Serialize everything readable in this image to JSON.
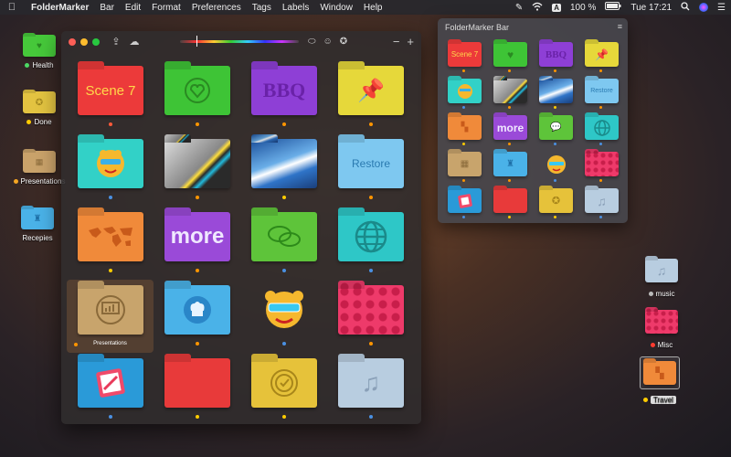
{
  "menubar": {
    "app": "FolderMarker",
    "items": [
      "Bar",
      "Edit",
      "Format",
      "Preferences",
      "Tags",
      "Labels",
      "Window",
      "Help"
    ],
    "battery": "100 %",
    "input_source": "A",
    "clock": "Tue 17:21"
  },
  "desktop_left": [
    {
      "label": "Health",
      "color": "#46c83a",
      "dot": "#4cd964",
      "icon": "heart-icon"
    },
    {
      "label": "Done",
      "color": "#e3c341",
      "dot": "#ffcc00",
      "icon": "badge-icon"
    },
    {
      "label": "Presentations",
      "color": "#c9a26a",
      "dot": "#f5a623",
      "icon": "presentation-icon"
    },
    {
      "label": "Recepies",
      "color": "#4ab2e8",
      "dot": "",
      "icon": "chef-hat-icon"
    }
  ],
  "main_window": {
    "folders": [
      {
        "name": "Scene 7",
        "text": "Scene 7",
        "color": "#ec3a3a",
        "dot": "#ff5a3a",
        "icon": ""
      },
      {
        "name": "Health",
        "text": "",
        "color": "#3ec436",
        "dot": "#ff9500",
        "icon": "heart-icon"
      },
      {
        "name": "BBQ",
        "text": "BBQ",
        "color": "#8e3fd6",
        "dot": "#ff9500",
        "icon": ""
      },
      {
        "name": "Pin",
        "text": "",
        "color": "#e6d83a",
        "dot": "#ff9500",
        "icon": "pin-icon"
      },
      {
        "name": "Tiger",
        "text": "",
        "color": "#32d1c7",
        "dot": "#4a90e2",
        "icon": "tiger-icon"
      },
      {
        "name": "Statue",
        "text": "",
        "color": "#555",
        "dot": "#ff9500",
        "icon": "statue-image"
      },
      {
        "name": "Sky",
        "text": "",
        "color": "#2f74c8",
        "dot": "#ffcc00",
        "icon": "photo-image"
      },
      {
        "name": "Restore",
        "text": "Restore",
        "color": "#7ec8f0",
        "dot": "#ff9500",
        "icon": ""
      },
      {
        "name": "Travel",
        "text": "",
        "color": "#f08a3a",
        "dot": "#ffcc00",
        "icon": "world-map-icon"
      },
      {
        "name": "more",
        "text": "more",
        "color": "#9a4ad8",
        "dot": "#ff9500",
        "icon": ""
      },
      {
        "name": "Chat",
        "text": "",
        "color": "#5ec43a",
        "dot": "#4a90e2",
        "icon": "chat-icon"
      },
      {
        "name": "Globe",
        "text": "",
        "color": "#2ec7c7",
        "dot": "#4a90e2",
        "icon": "globe-icon"
      },
      {
        "name": "Presentations",
        "text": "",
        "color": "#c8a46c",
        "dot": "#ff9500",
        "icon": "presentation-icon",
        "label": "Presentations",
        "selected": true
      },
      {
        "name": "Recepies",
        "text": "",
        "color": "#4ab2e8",
        "dot": "#ff9500",
        "icon": "chef-hat-icon"
      },
      {
        "name": "Tiger glasses",
        "text": "",
        "color": "transparent",
        "dot": "#4a90e2",
        "icon": "tiger-icon"
      },
      {
        "name": "Dots",
        "text": "",
        "color": "#ee3a6a",
        "dot": "#ff9500",
        "icon": "dots-pattern"
      },
      {
        "name": "Edit",
        "text": "",
        "color": "#2a9ad8",
        "dot": "#4a90e2",
        "icon": "pencil-icon"
      },
      {
        "name": "Red",
        "text": "",
        "color": "#e83a3a",
        "dot": "#ffcc00",
        "icon": ""
      },
      {
        "name": "Done",
        "text": "",
        "color": "#e6c23a",
        "dot": "#ffcc00",
        "icon": "badge-icon"
      },
      {
        "name": "Music",
        "text": "",
        "color": "#b8cde0",
        "dot": "#4a90e2",
        "icon": "music-note-icon"
      }
    ]
  },
  "bar_panel": {
    "title": "FolderMarker Bar",
    "menu_icon": "list-icon",
    "folders": [
      {
        "text": "Scene 7",
        "color": "#ec3a3a",
        "icon": "",
        "dot": "#ff9500"
      },
      {
        "text": "",
        "color": "#3ec436",
        "icon": "heart-icon",
        "dot": "#ff9500"
      },
      {
        "text": "BBQ",
        "color": "#8e3fd6",
        "icon": "",
        "dot": "#ff9500"
      },
      {
        "text": "",
        "color": "#e6d83a",
        "icon": "pin-icon",
        "dot": "#ff9500"
      },
      {
        "text": "",
        "color": "#32d1c7",
        "icon": "tiger-icon",
        "dot": "#4a90e2"
      },
      {
        "text": "",
        "color": "#555",
        "icon": "statue-image",
        "dot": "#ff9500"
      },
      {
        "text": "",
        "color": "#2f74c8",
        "icon": "photo-image",
        "dot": "#ffcc00"
      },
      {
        "text": "Restore",
        "color": "#7ec8f0",
        "icon": "",
        "dot": "#ff9500"
      },
      {
        "text": "",
        "color": "#f08a3a",
        "icon": "world-map-icon",
        "dot": "#ffcc00"
      },
      {
        "text": "more",
        "color": "#9a4ad8",
        "icon": "",
        "dot": "#ff9500"
      },
      {
        "text": "",
        "color": "#5ec43a",
        "icon": "chat-icon",
        "dot": "#4a90e2"
      },
      {
        "text": "",
        "color": "#2ec7c7",
        "icon": "globe-icon",
        "dot": "#4a90e2"
      },
      {
        "text": "",
        "color": "#c8a46c",
        "icon": "presentation-icon",
        "dot": "#ff9500"
      },
      {
        "text": "",
        "color": "#4ab2e8",
        "icon": "chef-hat-icon",
        "dot": "#ff9500"
      },
      {
        "text": "",
        "color": "transparent",
        "icon": "tiger-icon",
        "dot": "#4a90e2"
      },
      {
        "text": "",
        "color": "#ee3a6a",
        "icon": "dots-pattern",
        "dot": "#ff9500"
      },
      {
        "text": "",
        "color": "#2a9ad8",
        "icon": "pencil-icon",
        "dot": "#4a90e2"
      },
      {
        "text": "",
        "color": "#e83a3a",
        "icon": "",
        "dot": "#ffcc00"
      },
      {
        "text": "",
        "color": "#e6c23a",
        "icon": "badge-icon",
        "dot": "#ffcc00"
      },
      {
        "text": "",
        "color": "#b8cde0",
        "icon": "music-note-icon",
        "dot": "#4a90e2"
      }
    ]
  },
  "desktop_right": [
    {
      "label": "music",
      "color": "#b8cde0",
      "dot": "#bbbbbb",
      "icon": "music-note-icon"
    },
    {
      "label": "Misc",
      "color": "#ee3a6a",
      "dot": "#ff3b30",
      "icon": "dots-pattern"
    },
    {
      "label": "Travel",
      "color": "#f08a3a",
      "dot": "#ffcc00",
      "icon": "world-map-icon",
      "selected": true
    }
  ]
}
